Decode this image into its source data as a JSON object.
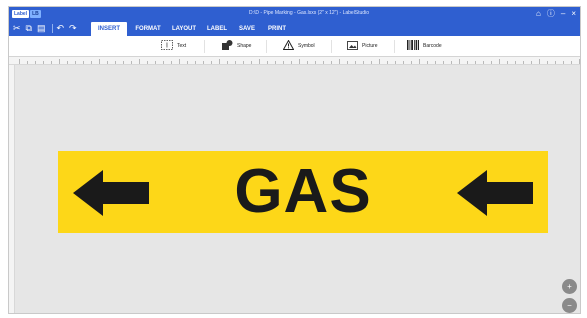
{
  "app": {
    "logo_left": "Label",
    "logo_right": "LB",
    "window_title": "D:\\D - Pipe Marking - Gas.lsxs (2\" x 12\") - LabelStudio"
  },
  "titlebar": {
    "home_icon": "home-icon",
    "help_icon": "help-icon",
    "minimize": "–",
    "close": "×"
  },
  "quick_access": {
    "icons": [
      "cut-icon",
      "copy-icon",
      "paste-icon",
      "undo-icon",
      "redo-icon"
    ]
  },
  "tabs": [
    {
      "label": "INSERT",
      "active": true
    },
    {
      "label": "FORMAT",
      "active": false
    },
    {
      "label": "LAYOUT",
      "active": false
    },
    {
      "label": "LABEL",
      "active": false
    },
    {
      "label": "SAVE",
      "active": false
    },
    {
      "label": "PRINT",
      "active": false
    }
  ],
  "ribbon": {
    "text": "Text",
    "shape": "Shape",
    "symbol": "Symbol",
    "picture": "Picture",
    "barcode": "Barcode"
  },
  "label": {
    "text": "GAS",
    "background_color": "#fdd718",
    "text_color": "#1a1a1a",
    "left_arrow_icon": "arrow-left-icon",
    "right_arrow_icon": "arrow-left-icon"
  },
  "zoom": {
    "zoom_in": "+",
    "zoom_out": "−"
  },
  "colors": {
    "accent": "#2f5fd0",
    "canvas": "#e6e6e6"
  }
}
